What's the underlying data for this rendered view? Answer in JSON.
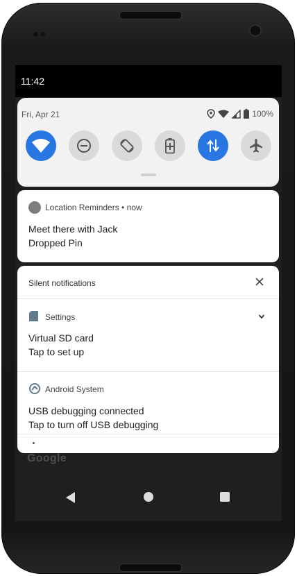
{
  "status_bar": {
    "time": "11:42"
  },
  "quick_settings": {
    "date": "Fri, Apr 21",
    "battery_percent": "100%",
    "tiles": [
      {
        "name": "wifi",
        "on": true
      },
      {
        "name": "do-not-disturb",
        "on": false
      },
      {
        "name": "auto-rotate",
        "on": false
      },
      {
        "name": "battery-saver",
        "on": false
      },
      {
        "name": "mobile-data",
        "on": true
      },
      {
        "name": "airplane-mode",
        "on": false
      }
    ]
  },
  "notification_location": {
    "app_line": "Location Reminders • now",
    "title": "Meet there with Jack",
    "text": "Dropped Pin"
  },
  "silent_section": {
    "header": "Silent notifications",
    "settings": {
      "app_name": "Settings",
      "title": "Virtual SD card",
      "text": "Tap to set up"
    },
    "android_system": {
      "app_name": "Android System",
      "title": "USB debugging connected",
      "text": "Tap to turn off USB debugging"
    }
  },
  "background": {
    "logo": "Google"
  },
  "colors": {
    "accent": "#2876e2",
    "tile_off": "#dadada",
    "panel": "#f2f2f2"
  }
}
